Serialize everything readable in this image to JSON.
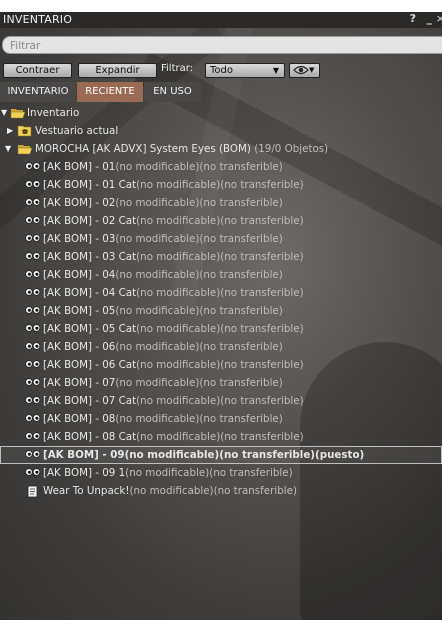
{
  "window": {
    "title": "INVENTARIO",
    "help": "?",
    "minimize": "_",
    "close": "×"
  },
  "search": {
    "placeholder": "Filtrar"
  },
  "toolbar": {
    "collapse_label": "Contraer",
    "expand_label": "Expandir",
    "filter_label": "Filtrar:",
    "filter_value": "Todo"
  },
  "tabs": [
    {
      "label": "INVENTARIO",
      "active": false
    },
    {
      "label": "RECIENTE",
      "active": true
    },
    {
      "label": "EN USO",
      "active": false
    }
  ],
  "tree": {
    "root": {
      "label": "Inventario"
    },
    "outfit": {
      "label": "Vestuario actual"
    },
    "folder": {
      "name": "MOROCHA [AK ADVX] System Eyes (BOM)",
      "count": "(19/0 Objetos)"
    },
    "items": [
      {
        "name": "[AK BOM] - 01",
        "perms": "(no modificable)(no transferible)"
      },
      {
        "name": "[AK BOM] - 01 Cat",
        "perms": "(no modificable)(no transferible)"
      },
      {
        "name": "[AK BOM] - 02",
        "perms": "(no modificable)(no transferible)"
      },
      {
        "name": "[AK BOM] - 02 Cat",
        "perms": "(no modificable)(no transferible)"
      },
      {
        "name": "[AK BOM] - 03",
        "perms": "(no modificable)(no transferible)"
      },
      {
        "name": "[AK BOM] - 03 Cat",
        "perms": "(no modificable)(no transferible)"
      },
      {
        "name": "[AK BOM] - 04",
        "perms": "(no modificable)(no transferible)"
      },
      {
        "name": "[AK BOM] - 04 Cat",
        "perms": "(no modificable)(no transferible)"
      },
      {
        "name": "[AK BOM] - 05",
        "perms": "(no modificable)(no transferible)"
      },
      {
        "name": "[AK BOM] - 05 Cat",
        "perms": "(no modificable)(no transferible)"
      },
      {
        "name": "[AK BOM] - 06",
        "perms": "(no modificable)(no transferible)"
      },
      {
        "name": "[AK BOM] - 06 Cat",
        "perms": "(no modificable)(no transferible)"
      },
      {
        "name": "[AK BOM] - 07",
        "perms": "(no modificable)(no transferible)"
      },
      {
        "name": "[AK BOM] - 07 Cat",
        "perms": "(no modificable)(no transferible)"
      },
      {
        "name": "[AK BOM] - 08",
        "perms": "(no modificable)(no transferible)"
      },
      {
        "name": "[AK BOM] - 08 Cat",
        "perms": "(no modificable)(no transferible)"
      },
      {
        "name": "[AK BOM] - 09",
        "perms": "(no modificable)(no transferible)(puesto)",
        "selected": true
      },
      {
        "name": "[AK BOM] - 09 1",
        "perms": "(no modificable)(no transferible)"
      }
    ],
    "script": {
      "name": "Wear To Unpack!",
      "perms": "(no modificable)(no transferible)"
    }
  },
  "colors": {
    "active_tab": "#9b6a54",
    "folder": "#e9c84a",
    "panel_dark": "#3f3d3b"
  }
}
